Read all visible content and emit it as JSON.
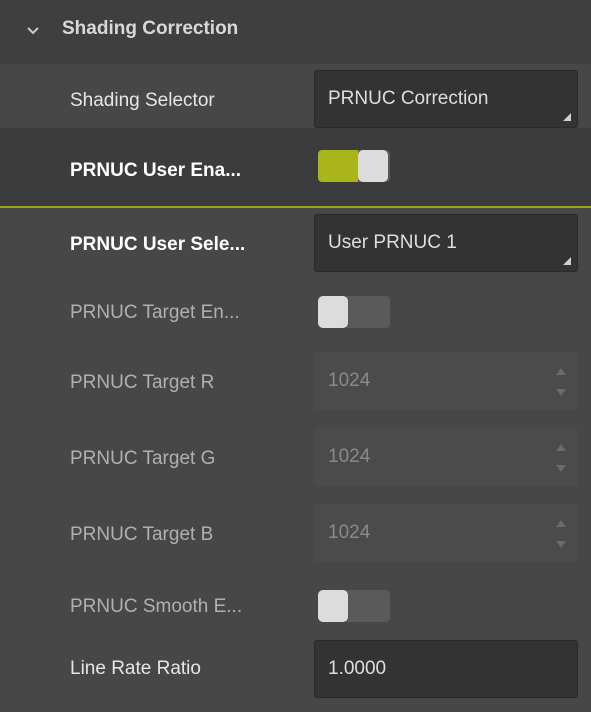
{
  "section": {
    "title": "Shading Correction",
    "icon": "chevron-down-icon"
  },
  "rows": [
    {
      "label": "Shading Selector",
      "type": "dropdown",
      "value": "PRNUC Correction"
    },
    {
      "label": "PRNUC User Ena...",
      "type": "toggle",
      "on": true
    },
    {
      "label": "PRNUC User Sele...",
      "type": "dropdown",
      "value": "User PRNUC 1"
    },
    {
      "label": "PRNUC Target En...",
      "type": "toggle",
      "on": false
    },
    {
      "label": "PRNUC Target R",
      "type": "spinbox",
      "value": "1024",
      "disabled": true
    },
    {
      "label": "PRNUC Target G",
      "type": "spinbox",
      "value": "1024",
      "disabled": true
    },
    {
      "label": "PRNUC Target B",
      "type": "spinbox",
      "value": "1024",
      "disabled": true
    },
    {
      "label": "PRNUC Smooth E...",
      "type": "toggle",
      "on": false
    },
    {
      "label": "Line Rate Ratio",
      "type": "text",
      "value": "1.0000"
    }
  ],
  "colors": {
    "accent": "#a9b51a",
    "background": "#474747",
    "field": "#333333"
  }
}
